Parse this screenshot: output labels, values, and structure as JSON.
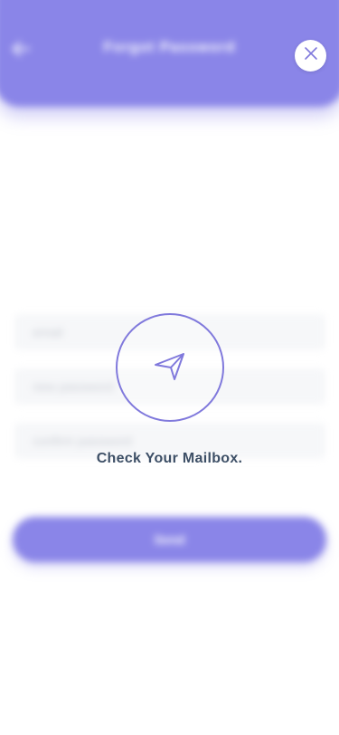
{
  "header": {
    "title": "Forgot Password",
    "back_icon": "arrow-left-icon"
  },
  "form": {
    "email_placeholder": "email",
    "new_password_placeholder": "new password",
    "confirm_password_placeholder": "confirm password",
    "send_label": "Send"
  },
  "modal": {
    "icon": "send-icon",
    "message": "Check Your Mailbox.",
    "close_icon": "close-icon"
  },
  "colors": {
    "accent": "#8a85e8",
    "icon_stroke": "#8079dc",
    "message_text": "#3d4f66",
    "input_bg": "#f6f7f9"
  }
}
